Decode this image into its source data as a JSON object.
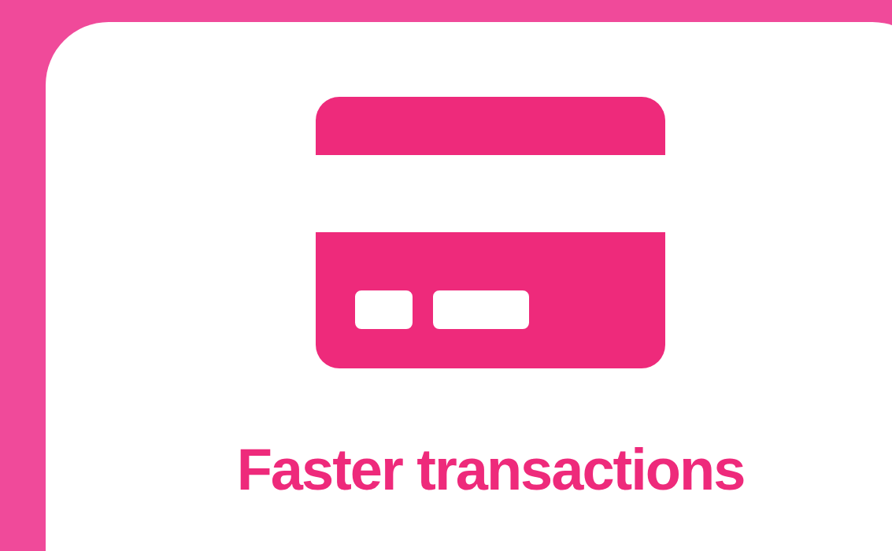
{
  "card": {
    "title": "Faster transactions"
  }
}
